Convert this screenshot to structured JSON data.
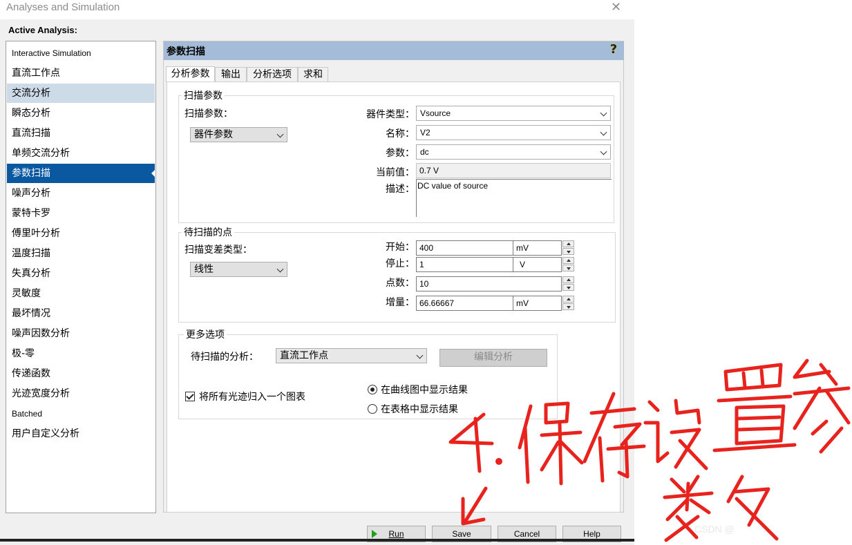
{
  "window": {
    "title": "Analyses and Simulation",
    "close_glyph": "✕"
  },
  "active_analysis_label": "Active Analysis:",
  "sidebar": {
    "items": [
      {
        "label": "Interactive Simulation"
      },
      {
        "label": "直流工作点"
      },
      {
        "label": "交流分析"
      },
      {
        "label": "瞬态分析"
      },
      {
        "label": "直流扫描"
      },
      {
        "label": "单频交流分析"
      },
      {
        "label": "参数扫描"
      },
      {
        "label": "噪声分析"
      },
      {
        "label": "蒙特卡罗"
      },
      {
        "label": "傅里叶分析"
      },
      {
        "label": "温度扫描"
      },
      {
        "label": "失真分析"
      },
      {
        "label": "灵敏度"
      },
      {
        "label": "最坏情况"
      },
      {
        "label": "噪声因数分析"
      },
      {
        "label": "极-零"
      },
      {
        "label": "传递函数"
      },
      {
        "label": "光迹宽度分析"
      },
      {
        "label": "Batched"
      },
      {
        "label": "用户自定义分析"
      }
    ],
    "selected_index": 6,
    "hover_index": 2
  },
  "panel": {
    "title": "参数扫描",
    "help_glyph": "?",
    "tabs": [
      "分析参数",
      "输出",
      "分析选项",
      "求和"
    ]
  },
  "sweep_params": {
    "legend": "扫描参数",
    "label": "扫描参数：",
    "type_value": "器件参数",
    "device_type_label": "器件类型：",
    "device_type_value": "Vsource",
    "name_label": "名称：",
    "name_value": "V2",
    "param_label": "参数：",
    "param_value": "dc",
    "current_label": "当前值：",
    "current_value": "0.7 V",
    "desc_label": "描述：",
    "desc_value": "DC value of source"
  },
  "points": {
    "legend": "待扫描的点",
    "variation_label": "扫描变差类型：",
    "variation_value": "线性",
    "start_label": "开始：",
    "start_value": "400",
    "start_unit": "mV",
    "stop_label": "停止：",
    "stop_value": "1",
    "stop_unit": "V",
    "count_label": "点数：",
    "count_value": "10",
    "inc_label": "增量：",
    "inc_value": "66.66667",
    "inc_unit": "mV"
  },
  "more": {
    "legend": "更多选项",
    "analysis_label": "待扫描的分析：",
    "analysis_value": "直流工作点",
    "edit_button": "编辑分析",
    "group_traces": "将所有光迹归入一个图表",
    "group_traces_checked": true,
    "show_plot": "在曲线图中显示结果",
    "show_table": "在表格中显示结果",
    "show_plot_selected": true
  },
  "buttons": {
    "run": "Run",
    "save": "Save",
    "cancel": "Cancel",
    "help": "Help"
  },
  "annotation": {
    "color": "#e8231e"
  },
  "colors": {
    "selection": "#0a58a0",
    "header": "#a4bcd8"
  }
}
